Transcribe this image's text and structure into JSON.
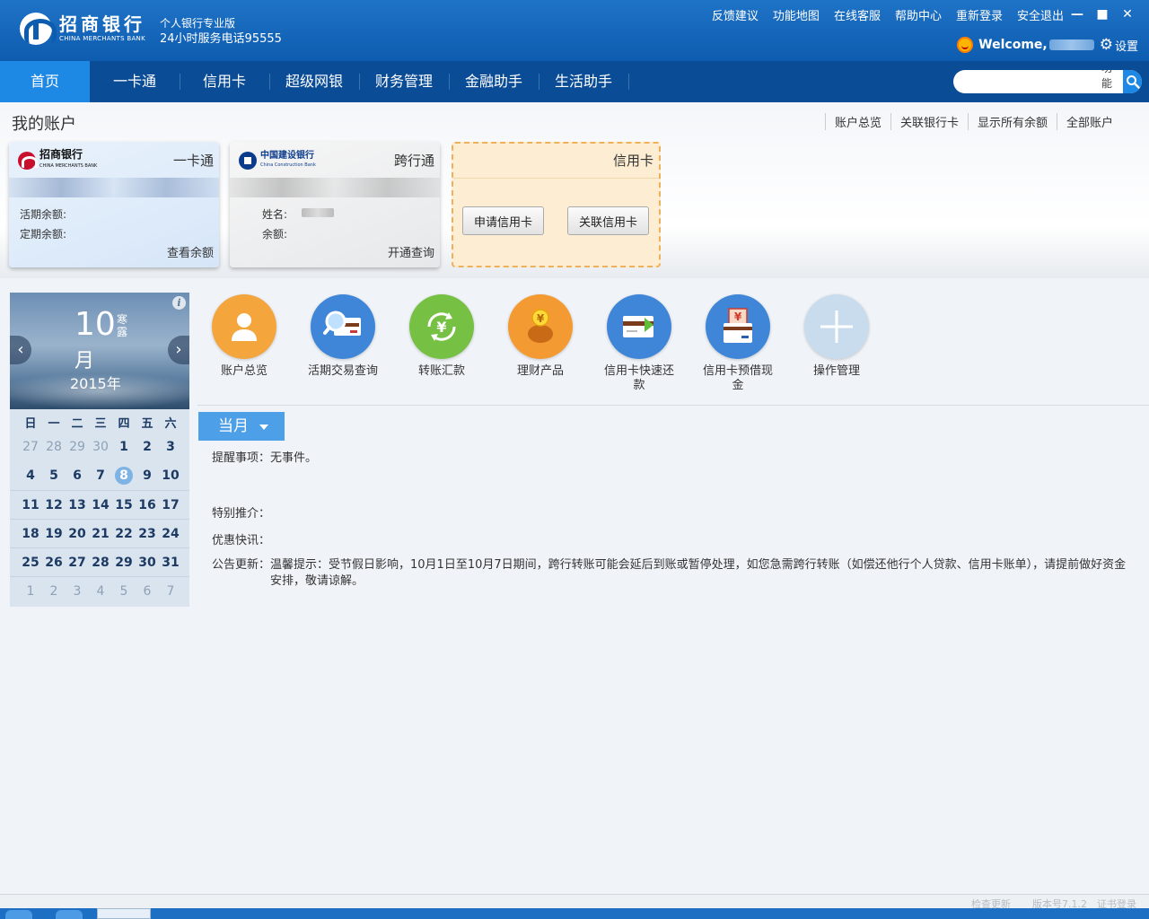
{
  "header": {
    "brand_cn": "招商银行",
    "brand_en": "CHINA MERCHANTS BANK",
    "edition": "个人银行专业版",
    "hotline": "24小时服务电话95555",
    "links": [
      "反馈建议",
      "功能地图",
      "在线客服",
      "帮助中心",
      "重新登录",
      "安全退出"
    ],
    "window_controls": [
      "minimize-icon",
      "maximize-icon",
      "close-icon"
    ],
    "welcome": "Welcome,",
    "settings": "设置"
  },
  "nav": {
    "items": [
      "首页",
      "一卡通",
      "信用卡",
      "超级网银",
      "财务管理",
      "金融助手",
      "生活助手"
    ],
    "active_index": 0,
    "search_placeholder": "",
    "search_scope": "功能"
  },
  "accounts": {
    "title": "我的账户",
    "links": [
      "账户总览",
      "关联银行卡",
      "显示所有余额",
      "全部账户"
    ],
    "cards": [
      {
        "bank_cn": "招商银行",
        "bank_en": "CHINA MERCHANTS BANK",
        "type": "一卡通",
        "label1": "活期余额:",
        "label2": "定期余额:",
        "action": "查看余额"
      },
      {
        "bank_cn": "中国建设银行",
        "bank_en": "China Construction Bank",
        "type": "跨行通",
        "label1": "姓名:",
        "label2": "余额:",
        "action": "开通查询"
      },
      {
        "type": "信用卡",
        "button1": "申请信用卡",
        "button2": "关联信用卡"
      }
    ]
  },
  "calendar": {
    "day": "10",
    "month_unit": "月",
    "solar_term": "寒露",
    "year": "2015年",
    "weekdays": [
      "日",
      "一",
      "二",
      "三",
      "四",
      "五",
      "六"
    ],
    "weeks": [
      [
        "27",
        "28",
        "29",
        "30",
        "1",
        "2",
        "3"
      ],
      [
        "4",
        "5",
        "6",
        "7",
        "8",
        "9",
        "10"
      ],
      [
        "11",
        "12",
        "13",
        "14",
        "15",
        "16",
        "17"
      ],
      [
        "18",
        "19",
        "20",
        "21",
        "22",
        "23",
        "24"
      ],
      [
        "25",
        "26",
        "27",
        "28",
        "29",
        "30",
        "31"
      ],
      [
        "1",
        "2",
        "3",
        "4",
        "5",
        "6",
        "7"
      ]
    ],
    "today": "8"
  },
  "functions": [
    {
      "label": "账户总览",
      "icon": "user-icon",
      "color": "#f4a53c"
    },
    {
      "label": "活期交易查询",
      "icon": "magnifier-card-icon",
      "color": "#3f86d8"
    },
    {
      "label": "转账汇款",
      "icon": "yen-transfer-icon",
      "color": "#76c043"
    },
    {
      "label": "理财产品",
      "icon": "piggy-bank-icon",
      "color": "#f39a32"
    },
    {
      "label": "信用卡快速还款",
      "icon": "card-repay-icon",
      "color": "#3f86d8"
    },
    {
      "label": "信用卡预借现金",
      "icon": "card-cash-icon",
      "color": "#3f86d8"
    },
    {
      "label": "操作管理",
      "icon": "plus-icon",
      "color": "#c9dced"
    }
  ],
  "panel": {
    "month_button": "当月",
    "reminder": "提醒事项：无事件。",
    "recommend": "特别推介：",
    "promo": "优惠快讯：",
    "notice_label": "公告更新：",
    "notice_text": "温馨提示：受节假日影响，10月1日至10月7日期间，跨行转账可能会延后到账或暂停处理，如您急需跨行转账（如偿还他行个人贷款、信用卡账单），请提前做好资金安排，敬请谅解。"
  },
  "footer": {
    "check_update": "检查更新",
    "version": "版本号7.1.2",
    "login_status": "证书登录"
  }
}
